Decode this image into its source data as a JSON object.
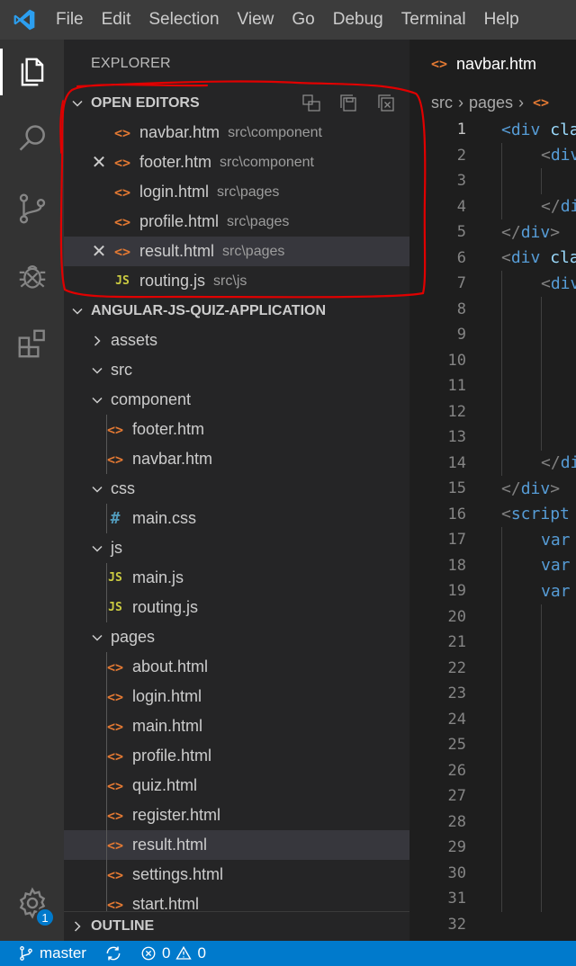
{
  "menu": [
    "File",
    "Edit",
    "Selection",
    "View",
    "Go",
    "Debug",
    "Terminal",
    "Help"
  ],
  "activity": {
    "items": [
      "explorer-icon",
      "search-icon",
      "source-control-icon",
      "debug-icon",
      "extensions-icon",
      "settings-gear-icon"
    ],
    "settings_badge": "1"
  },
  "sidebar": {
    "title": "EXPLORER",
    "open_editors": {
      "header": "OPEN EDITORS",
      "items": [
        {
          "name": "navbar.htm",
          "path": "src\\component",
          "type": "html",
          "dirty": false
        },
        {
          "name": "footer.htm",
          "path": "src\\component",
          "type": "html",
          "dirty": true
        },
        {
          "name": "login.html",
          "path": "src\\pages",
          "type": "html",
          "dirty": false
        },
        {
          "name": "profile.html",
          "path": "src\\pages",
          "type": "html",
          "dirty": false
        },
        {
          "name": "result.html",
          "path": "src\\pages",
          "type": "html",
          "dirty": true
        },
        {
          "name": "routing.js",
          "path": "src\\js",
          "type": "js",
          "dirty": false
        }
      ]
    },
    "project": {
      "header": "ANGULAR-JS-QUIZ-APPLICATION",
      "tree": [
        {
          "label": "assets",
          "kind": "folder",
          "expanded": false,
          "depth": 0
        },
        {
          "label": "src",
          "kind": "folder",
          "expanded": true,
          "depth": 0
        },
        {
          "label": "component",
          "kind": "folder",
          "expanded": true,
          "depth": 1
        },
        {
          "label": "footer.htm",
          "kind": "html",
          "depth": 2
        },
        {
          "label": "navbar.htm",
          "kind": "html",
          "depth": 2
        },
        {
          "label": "css",
          "kind": "folder",
          "expanded": true,
          "depth": 1
        },
        {
          "label": "main.css",
          "kind": "css",
          "depth": 2
        },
        {
          "label": "js",
          "kind": "folder",
          "expanded": true,
          "depth": 1
        },
        {
          "label": "main.js",
          "kind": "js",
          "depth": 2
        },
        {
          "label": "routing.js",
          "kind": "js",
          "depth": 2
        },
        {
          "label": "pages",
          "kind": "folder",
          "expanded": true,
          "depth": 1
        },
        {
          "label": "about.html",
          "kind": "html",
          "depth": 2
        },
        {
          "label": "login.html",
          "kind": "html",
          "depth": 2
        },
        {
          "label": "main.html",
          "kind": "html",
          "depth": 2
        },
        {
          "label": "profile.html",
          "kind": "html",
          "depth": 2
        },
        {
          "label": "quiz.html",
          "kind": "html",
          "depth": 2
        },
        {
          "label": "register.html",
          "kind": "html",
          "depth": 2
        },
        {
          "label": "result.html",
          "kind": "html",
          "depth": 2,
          "selected": true
        },
        {
          "label": "settings.html",
          "kind": "html",
          "depth": 2
        },
        {
          "label": "start.html",
          "kind": "html",
          "depth": 2
        }
      ]
    },
    "outline_header": "OUTLINE"
  },
  "editor": {
    "tab": "navbar.htm",
    "breadcrumb": [
      "src",
      "pages"
    ],
    "current_line": 1,
    "lines": [
      {
        "n": 1,
        "indent": 0,
        "parts": [
          [
            "tag",
            "<div"
          ],
          [
            "attr",
            " cla"
          ]
        ]
      },
      {
        "n": 2,
        "indent": 1,
        "parts": [
          [
            "punc",
            "<"
          ],
          [
            "tag",
            "div"
          ]
        ]
      },
      {
        "n": 3,
        "indent": 2,
        "parts": []
      },
      {
        "n": 4,
        "indent": 1,
        "parts": [
          [
            "punc",
            "</"
          ],
          [
            "tag",
            "di"
          ]
        ]
      },
      {
        "n": 5,
        "indent": 0,
        "parts": [
          [
            "punc",
            "</"
          ],
          [
            "tag",
            "div"
          ],
          [
            "punc",
            ">"
          ]
        ]
      },
      {
        "n": 6,
        "indent": 0,
        "parts": [
          [
            "punc",
            "<"
          ],
          [
            "tag",
            "div"
          ],
          [
            "attr",
            " cla"
          ]
        ]
      },
      {
        "n": 7,
        "indent": 1,
        "parts": [
          [
            "punc",
            "<"
          ],
          [
            "tag",
            "div"
          ]
        ]
      },
      {
        "n": 8,
        "indent": 2,
        "parts": []
      },
      {
        "n": 9,
        "indent": 2,
        "parts": []
      },
      {
        "n": 10,
        "indent": 2,
        "parts": []
      },
      {
        "n": 11,
        "indent": 2,
        "parts": []
      },
      {
        "n": 12,
        "indent": 2,
        "parts": []
      },
      {
        "n": 13,
        "indent": 2,
        "parts": []
      },
      {
        "n": 14,
        "indent": 1,
        "parts": [
          [
            "punc",
            "</"
          ],
          [
            "tag",
            "di"
          ]
        ]
      },
      {
        "n": 15,
        "indent": 0,
        "parts": [
          [
            "punc",
            "</"
          ],
          [
            "tag",
            "div"
          ],
          [
            "punc",
            ">"
          ]
        ]
      },
      {
        "n": 16,
        "indent": 0,
        "parts": [
          [
            "punc",
            "<"
          ],
          [
            "tag",
            "script"
          ]
        ]
      },
      {
        "n": 17,
        "indent": 1,
        "parts": [
          [
            "kw",
            "var"
          ]
        ]
      },
      {
        "n": 18,
        "indent": 1,
        "parts": [
          [
            "kw",
            "var"
          ]
        ]
      },
      {
        "n": 19,
        "indent": 1,
        "parts": [
          [
            "kw",
            "var"
          ]
        ]
      },
      {
        "n": 20,
        "indent": 2,
        "parts": []
      },
      {
        "n": 21,
        "indent": 2,
        "parts": []
      },
      {
        "n": 22,
        "indent": 2,
        "parts": []
      },
      {
        "n": 23,
        "indent": 2,
        "parts": []
      },
      {
        "n": 24,
        "indent": 2,
        "parts": []
      },
      {
        "n": 25,
        "indent": 2,
        "parts": []
      },
      {
        "n": 26,
        "indent": 2,
        "parts": []
      },
      {
        "n": 27,
        "indent": 2,
        "parts": []
      },
      {
        "n": 28,
        "indent": 2,
        "parts": []
      },
      {
        "n": 29,
        "indent": 2,
        "parts": []
      },
      {
        "n": 30,
        "indent": 2,
        "parts": []
      },
      {
        "n": 31,
        "indent": 2,
        "parts": []
      },
      {
        "n": 32,
        "indent": 0,
        "parts": []
      }
    ]
  },
  "status": {
    "branch": "master",
    "errors": "0",
    "warnings": "0"
  },
  "colors": {
    "accent": "#007acc",
    "annotation": "#e00000",
    "html_icon": "#e37933",
    "js_icon": "#cbcb41",
    "css_icon": "#519aba"
  }
}
